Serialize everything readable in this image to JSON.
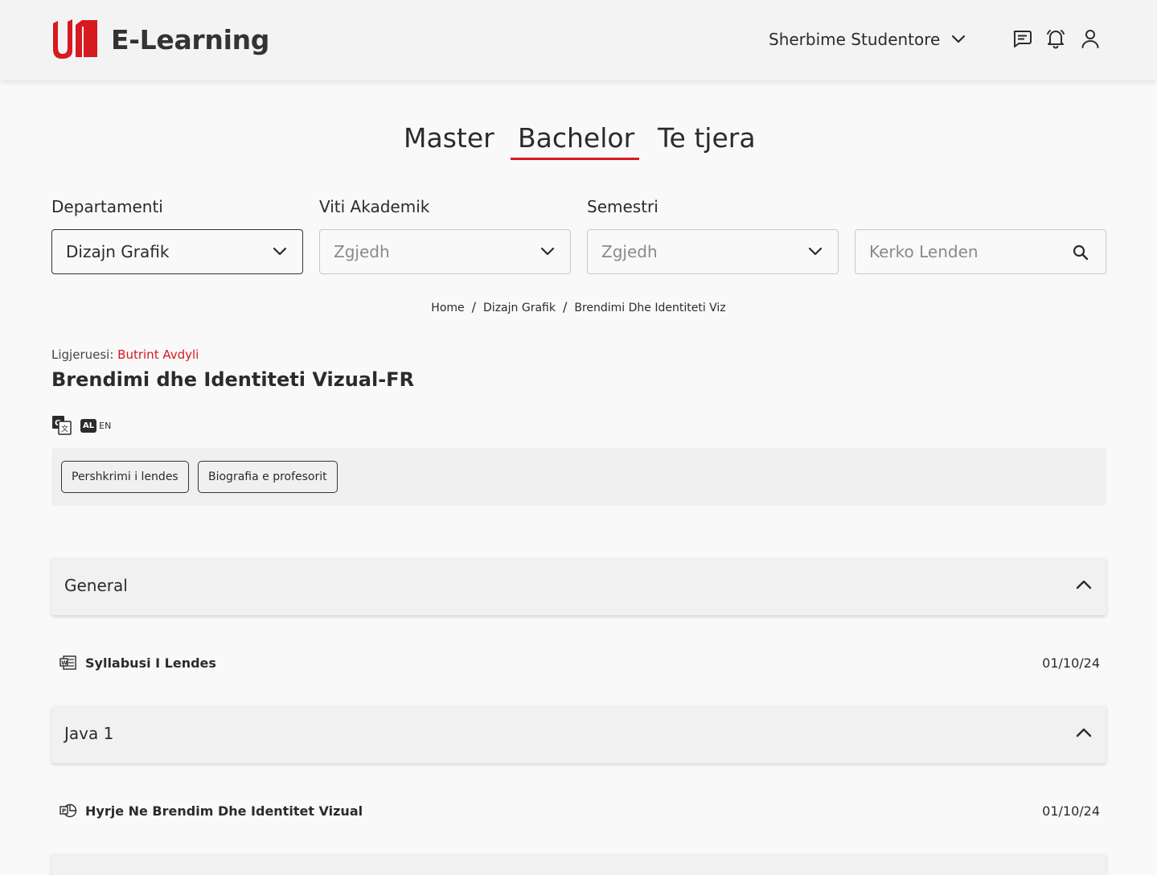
{
  "header": {
    "brand": "E-Learning",
    "services_label": "Sherbime Studentore",
    "icons": [
      "chat-icon",
      "bell-icon",
      "user-icon"
    ]
  },
  "tabs": [
    {
      "label": "Master",
      "active": false
    },
    {
      "label": "Bachelor",
      "active": true
    },
    {
      "label": "Te tjera",
      "active": false
    }
  ],
  "filters": {
    "department": {
      "label": "Departamenti",
      "value": "Dizajn Grafik"
    },
    "year": {
      "label": "Viti Akademik",
      "placeholder": "Zgjedh"
    },
    "semester": {
      "label": "Semestri",
      "placeholder": "Zgjedh"
    },
    "search": {
      "placeholder": "Kerko Lenden"
    }
  },
  "breadcrumb": [
    "Home",
    "Dizajn Grafik",
    "Brendimi Dhe Identiteti Viz"
  ],
  "course": {
    "lecturer_label": "Ligjeruesi:",
    "lecturer_name": "Butrint Avdyli",
    "title": "Brendimi dhe Identiteti Vizual-FR",
    "lang_al": "AL",
    "lang_en": "EN"
  },
  "buttons": {
    "description": "Pershkrimi i lendes",
    "biography": "Biografia e profesorit"
  },
  "sections": [
    {
      "title": "General",
      "items": [
        {
          "name": "Syllabusi I Lendes",
          "date": "01/10/24",
          "icon": "word-document-icon"
        }
      ]
    },
    {
      "title": "Java 1",
      "items": [
        {
          "name": "Hyrje Ne Brendim Dhe Identitet Vizual",
          "date": "01/10/24",
          "icon": "powerpoint-icon"
        }
      ]
    }
  ],
  "colors": {
    "accent": "#d71920",
    "text": "#2b2b2b",
    "background": "#f9f9f9"
  }
}
